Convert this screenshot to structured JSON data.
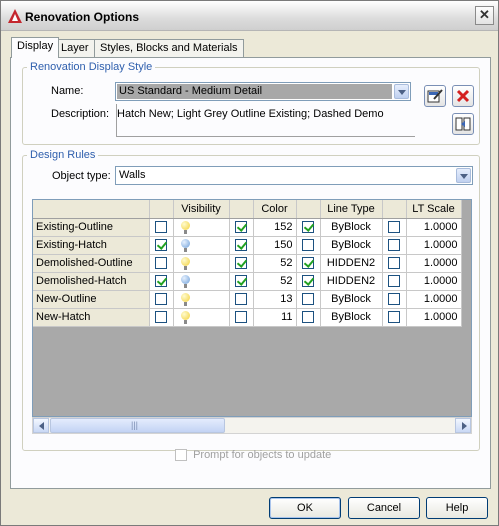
{
  "window": {
    "title": "Renovation Options",
    "close_glyph": "✕"
  },
  "tabs": [
    {
      "label": "Display",
      "active": true
    },
    {
      "label": "Layer",
      "active": false
    },
    {
      "label": "Styles, Blocks and Materials",
      "active": false
    }
  ],
  "display_style": {
    "group_label": "Renovation Display Style",
    "name_label": "Name:",
    "name_value": "US Standard - Medium Detail",
    "description_label": "Description:",
    "description_value": "Hatch New; Light Grey Outline Existing; Dashed Demo",
    "edit_icon": "edit-style-icon",
    "delete_icon": "delete-icon",
    "import_icon": "import-style-icon"
  },
  "design_rules": {
    "group_label": "Design Rules",
    "object_type_label": "Object type:",
    "object_type_value": "Walls"
  },
  "grid": {
    "headers": [
      "",
      "",
      "Visibility",
      "",
      "Color",
      "",
      "Line Type",
      "",
      "LT Scale"
    ],
    "rows": [
      {
        "name": "Existing-Outline",
        "check1": false,
        "bulb_on": true,
        "check2": true,
        "color": "152",
        "color_hex": "#a8a8a8",
        "check3": true,
        "linetype": "ByBlock",
        "check4": false,
        "ltscale": "1.0000"
      },
      {
        "name": "Existing-Hatch",
        "check1": true,
        "bulb_on": false,
        "check2": true,
        "color": "150",
        "color_hex": "#6f9bd8",
        "check3": false,
        "linetype": "ByBlock",
        "check4": false,
        "ltscale": "1.0000"
      },
      {
        "name": "Demolished-Outline",
        "check1": false,
        "bulb_on": true,
        "check2": true,
        "color": "52",
        "color_hex": "#e0d64a",
        "check3": true,
        "linetype": "HIDDEN2",
        "check4": false,
        "ltscale": "1.0000"
      },
      {
        "name": "Demolished-Hatch",
        "check1": true,
        "bulb_on": false,
        "check2": true,
        "color": "52",
        "color_hex": "#e0d64a",
        "check3": true,
        "linetype": "HIDDEN2",
        "check4": false,
        "ltscale": "1.0000"
      },
      {
        "name": "New-Outline",
        "check1": false,
        "bulb_on": true,
        "check2": false,
        "color": "13",
        "color_hex": "#d64a3a",
        "check3": false,
        "linetype": "ByBlock",
        "check4": false,
        "ltscale": "1.0000"
      },
      {
        "name": "New-Hatch",
        "check1": false,
        "bulb_on": true,
        "check2": false,
        "color": "11",
        "color_hex": "#e08a8a",
        "check3": false,
        "linetype": "ByBlock",
        "check4": false,
        "ltscale": "1.0000"
      }
    ]
  },
  "scrollbar": {
    "thumb_grip": "|||"
  },
  "prompt_checkbox_label": "Prompt for objects to update",
  "buttons": {
    "ok": "OK",
    "cancel": "Cancel",
    "help": "Help"
  }
}
